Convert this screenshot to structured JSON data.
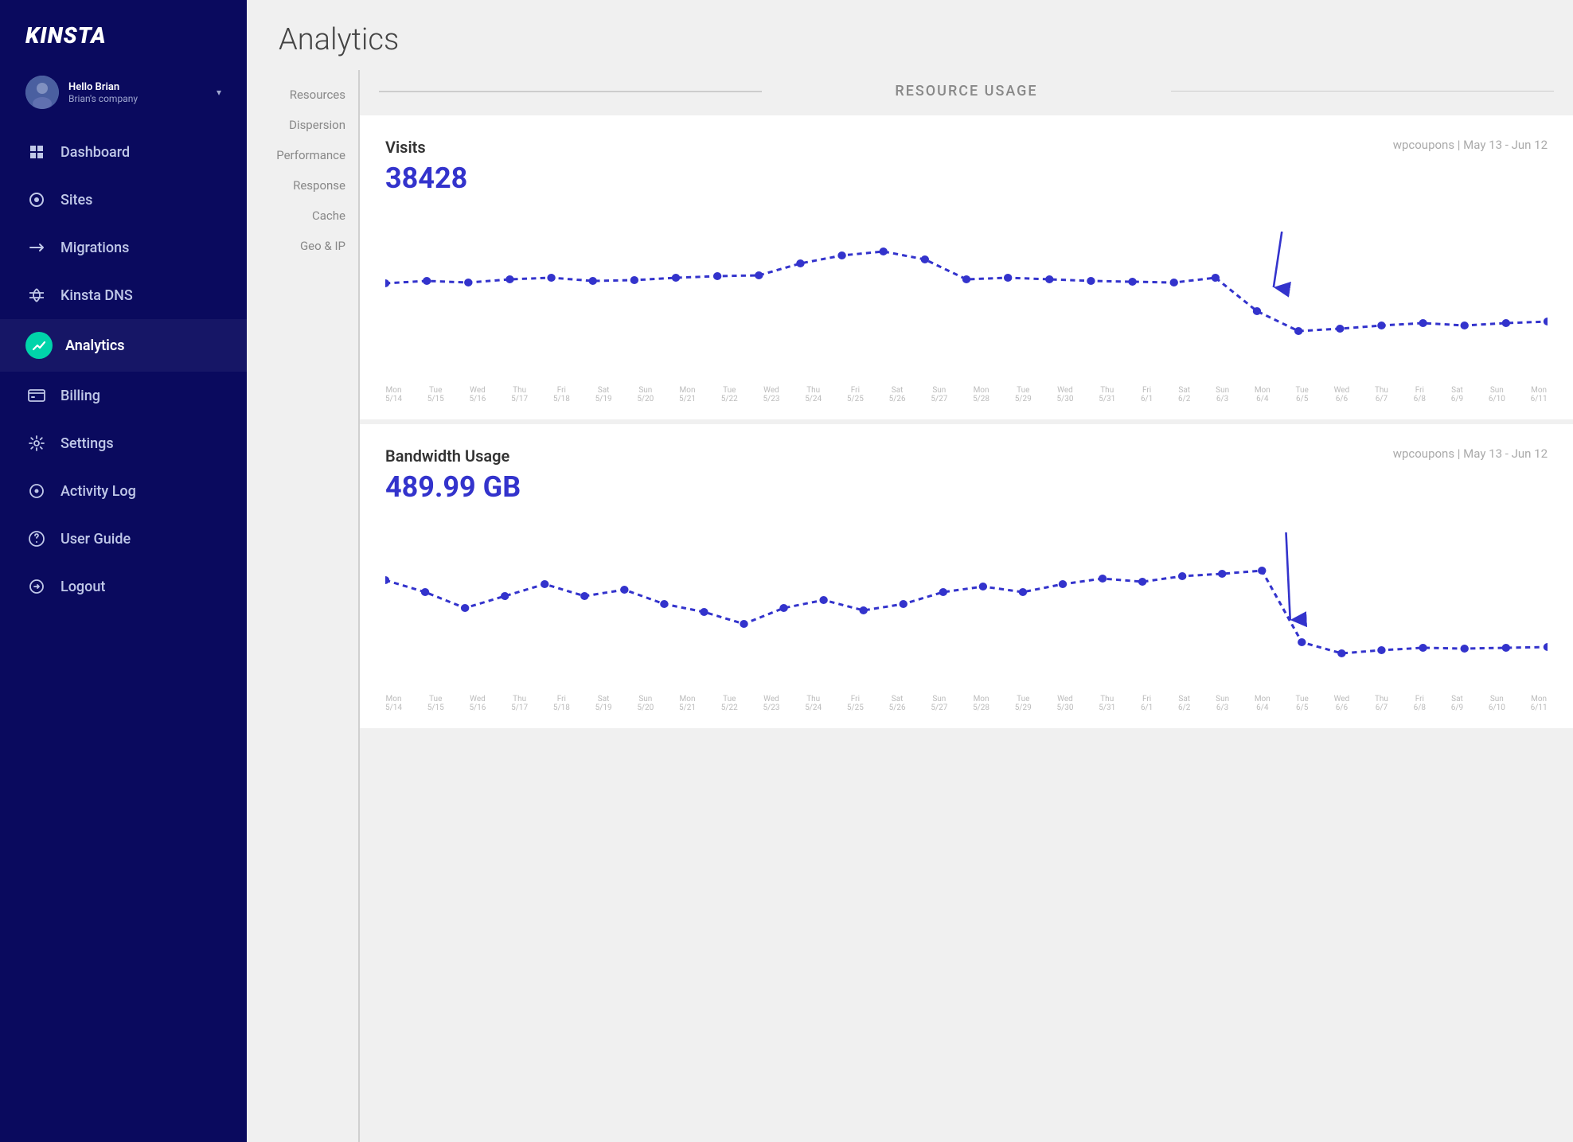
{
  "brand": {
    "logo": "KINSTA"
  },
  "user": {
    "greeting": "Hello Brian",
    "company": "Brian's company",
    "avatar_emoji": "👤"
  },
  "nav": {
    "items": [
      {
        "id": "dashboard",
        "label": "Dashboard",
        "icon": "⌂"
      },
      {
        "id": "sites",
        "label": "Sites",
        "icon": "◎"
      },
      {
        "id": "migrations",
        "label": "Migrations",
        "icon": "→"
      },
      {
        "id": "kinsta-dns",
        "label": "Kinsta DNS",
        "icon": "⇌"
      },
      {
        "id": "analytics",
        "label": "Analytics",
        "icon": "📈",
        "active": true
      },
      {
        "id": "billing",
        "label": "Billing",
        "icon": "▤"
      },
      {
        "id": "settings",
        "label": "Settings",
        "icon": "⚙"
      },
      {
        "id": "activity-log",
        "label": "Activity Log",
        "icon": "◉"
      },
      {
        "id": "user-guide",
        "label": "User Guide",
        "icon": "?"
      },
      {
        "id": "logout",
        "label": "Logout",
        "icon": "↩"
      }
    ]
  },
  "page_title": "Analytics",
  "sub_nav": {
    "items": [
      {
        "id": "resources",
        "label": "Resources"
      },
      {
        "id": "dispersion",
        "label": "Dispersion"
      },
      {
        "id": "performance",
        "label": "Performance"
      },
      {
        "id": "response",
        "label": "Response"
      },
      {
        "id": "cache",
        "label": "Cache"
      },
      {
        "id": "geo-ip",
        "label": "Geo & IP"
      }
    ]
  },
  "resource_usage_label": "RESOURCE USAGE",
  "charts": [
    {
      "id": "visits",
      "title": "Visits",
      "value": "38428",
      "subtitle": "wpcoupons | May 13 - Jun 12",
      "color": "#3333cc",
      "x_labels": [
        {
          "day": "Mon",
          "date": "5/14"
        },
        {
          "day": "Tue",
          "date": "5/15"
        },
        {
          "day": "Wed",
          "date": "5/16"
        },
        {
          "day": "Thu",
          "date": "5/17"
        },
        {
          "day": "Fri",
          "date": "5/18"
        },
        {
          "day": "Sat",
          "date": "5/19"
        },
        {
          "day": "Sun",
          "date": "5/20"
        },
        {
          "day": "Mon",
          "date": "5/21"
        },
        {
          "day": "Tue",
          "date": "5/22"
        },
        {
          "day": "Wed",
          "date": "5/23"
        },
        {
          "day": "Thu",
          "date": "5/24"
        },
        {
          "day": "Fri",
          "date": "5/25"
        },
        {
          "day": "Sat",
          "date": "5/26"
        },
        {
          "day": "Sun",
          "date": "5/27"
        },
        {
          "day": "Mon",
          "date": "5/28"
        },
        {
          "day": "Tue",
          "date": "5/29"
        },
        {
          "day": "Wed",
          "date": "5/30"
        },
        {
          "day": "Thu",
          "date": "5/31"
        },
        {
          "day": "Fri",
          "date": "6/1"
        },
        {
          "day": "Sat",
          "date": "6/2"
        },
        {
          "day": "Sun",
          "date": "6/3"
        },
        {
          "day": "Mon",
          "date": "6/4"
        },
        {
          "day": "Tue",
          "date": "6/5"
        },
        {
          "day": "Wed",
          "date": "6/6"
        },
        {
          "day": "Thu",
          "date": "6/7"
        },
        {
          "day": "Fri",
          "date": "6/8"
        },
        {
          "day": "Sat",
          "date": "6/9"
        },
        {
          "day": "Sun",
          "date": "6/10"
        },
        {
          "day": "Mon",
          "date": "6/11"
        }
      ]
    },
    {
      "id": "bandwidth",
      "title": "Bandwidth Usage",
      "value": "489.99 GB",
      "subtitle": "wpcoupons | May 13 - Jun 12",
      "color": "#3333cc",
      "x_labels": [
        {
          "day": "Mon",
          "date": "5/14"
        },
        {
          "day": "Tue",
          "date": "5/15"
        },
        {
          "day": "Wed",
          "date": "5/16"
        },
        {
          "day": "Thu",
          "date": "5/17"
        },
        {
          "day": "Fri",
          "date": "5/18"
        },
        {
          "day": "Sat",
          "date": "5/19"
        },
        {
          "day": "Sun",
          "date": "5/20"
        },
        {
          "day": "Mon",
          "date": "5/21"
        },
        {
          "day": "Tue",
          "date": "5/22"
        },
        {
          "day": "Wed",
          "date": "5/23"
        },
        {
          "day": "Thu",
          "date": "5/24"
        },
        {
          "day": "Fri",
          "date": "5/25"
        },
        {
          "day": "Sat",
          "date": "5/26"
        },
        {
          "day": "Sun",
          "date": "5/27"
        },
        {
          "day": "Mon",
          "date": "5/28"
        },
        {
          "day": "Tue",
          "date": "5/29"
        },
        {
          "day": "Wed",
          "date": "5/30"
        },
        {
          "day": "Thu",
          "date": "5/31"
        },
        {
          "day": "Fri",
          "date": "6/1"
        },
        {
          "day": "Sat",
          "date": "6/2"
        },
        {
          "day": "Sun",
          "date": "6/3"
        },
        {
          "day": "Mon",
          "date": "6/4"
        },
        {
          "day": "Tue",
          "date": "6/5"
        },
        {
          "day": "Wed",
          "date": "6/6"
        },
        {
          "day": "Thu",
          "date": "6/7"
        },
        {
          "day": "Fri",
          "date": "6/8"
        },
        {
          "day": "Sat",
          "date": "6/9"
        },
        {
          "day": "Sun",
          "date": "6/10"
        },
        {
          "day": "Mon",
          "date": "6/11"
        }
      ]
    }
  ]
}
